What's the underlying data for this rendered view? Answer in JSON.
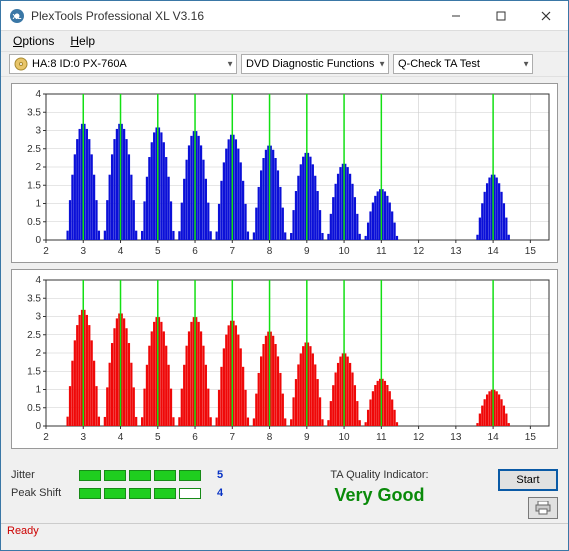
{
  "window": {
    "title": "PlexTools Professional XL V3.16"
  },
  "menu": {
    "options": "Options",
    "help": "Help"
  },
  "toolbar": {
    "device": "HA:8 ID:0   PX-760A",
    "func": "DVD Diagnostic Functions",
    "test": "Q-Check TA Test"
  },
  "chart_data": [
    {
      "type": "bar",
      "color": "#0b10d8",
      "xlim": [
        2,
        15.5
      ],
      "ylim": [
        0,
        4
      ],
      "xticks": [
        2,
        3,
        4,
        5,
        6,
        7,
        8,
        9,
        10,
        11,
        12,
        13,
        14,
        15
      ],
      "yticks": [
        0,
        0.5,
        1,
        1.5,
        2,
        2.5,
        3,
        3.5,
        4
      ],
      "markerlines": [
        3,
        4,
        5,
        6,
        7,
        8,
        9,
        10,
        11,
        14
      ],
      "peaks": [
        {
          "x": 3,
          "h": 3.2
        },
        {
          "x": 4,
          "h": 3.2
        },
        {
          "x": 5,
          "h": 3.1
        },
        {
          "x": 6,
          "h": 3.0
        },
        {
          "x": 7,
          "h": 2.9
        },
        {
          "x": 8,
          "h": 2.6
        },
        {
          "x": 9,
          "h": 2.4
        },
        {
          "x": 10,
          "h": 2.1
        },
        {
          "x": 11,
          "h": 1.4
        },
        {
          "x": 14,
          "h": 1.8
        }
      ]
    },
    {
      "type": "bar",
      "color": "#ef0808",
      "xlim": [
        2,
        15.5
      ],
      "ylim": [
        0,
        4
      ],
      "xticks": [
        2,
        3,
        4,
        5,
        6,
        7,
        8,
        9,
        10,
        11,
        12,
        13,
        14,
        15
      ],
      "yticks": [
        0,
        0.5,
        1,
        1.5,
        2,
        2.5,
        3,
        3.5,
        4
      ],
      "markerlines": [
        3,
        4,
        5,
        6,
        7,
        8,
        9,
        10,
        11,
        14
      ],
      "peaks": [
        {
          "x": 3,
          "h": 3.2
        },
        {
          "x": 4,
          "h": 3.1
        },
        {
          "x": 5,
          "h": 3.0
        },
        {
          "x": 6,
          "h": 3.0
        },
        {
          "x": 7,
          "h": 2.9
        },
        {
          "x": 8,
          "h": 2.6
        },
        {
          "x": 9,
          "h": 2.3
        },
        {
          "x": 10,
          "h": 2.0
        },
        {
          "x": 11,
          "h": 1.3
        },
        {
          "x": 14,
          "h": 1.0
        }
      ]
    }
  ],
  "meters": {
    "jitter": {
      "label": "Jitter",
      "filled": 5,
      "total": 5,
      "value": "5"
    },
    "peak": {
      "label": "Peak Shift",
      "filled": 4,
      "total": 5,
      "value": "4"
    }
  },
  "quality": {
    "label": "TA Quality Indicator:",
    "value": "Very Good"
  },
  "buttons": {
    "start": "Start"
  },
  "status": "Ready"
}
